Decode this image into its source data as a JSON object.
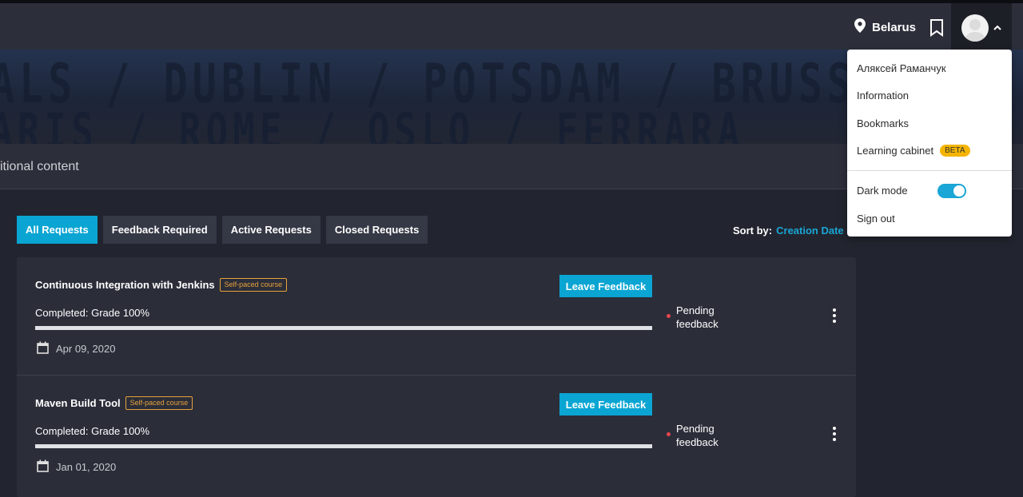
{
  "header": {
    "location": "Belarus",
    "icons": [
      "location-pin-icon",
      "bookmark-icon",
      "avatar-icon",
      "chevron-up-icon"
    ]
  },
  "banner": {
    "row1": "ALS / DUBLIN / POTSDAM / BRUSSELS",
    "row2": "ARIS / ROME / OSLO / FERRARA"
  },
  "subheader": {
    "text": "itional content"
  },
  "tabs": [
    {
      "label": "All Requests",
      "active": true
    },
    {
      "label": "Feedback Required",
      "active": false
    },
    {
      "label": "Active Requests",
      "active": false
    },
    {
      "label": "Closed Requests",
      "active": false
    }
  ],
  "sort": {
    "label": "Sort by:",
    "value": "Creation Date"
  },
  "requests": [
    {
      "title": "Continuous Integration with Jenkins",
      "badge": "Self-paced course",
      "button": "Leave Feedback",
      "completed": "Completed: Grade 100%",
      "progress_pct": 100,
      "date": "Apr 09, 2020",
      "status": "Pending feedback"
    },
    {
      "title": "Maven Build Tool",
      "badge": "Self-paced course",
      "button": "Leave Feedback",
      "completed": "Completed: Grade 100%",
      "progress_pct": 100,
      "date": "Jan 01, 2020",
      "status": "Pending feedback"
    }
  ],
  "menu": {
    "user_name": "Аляксей Раманчук",
    "information": "Information",
    "bookmarks": "Bookmarks",
    "learning_cabinet": "Learning cabinet",
    "beta": "BETA",
    "dark_mode": "Dark mode",
    "dark_mode_on": true,
    "sign_out": "Sign out"
  },
  "colors": {
    "accent": "#0aa5d3",
    "badge": "#e7a23a",
    "status_dot": "#e8454e",
    "beta": "#f4b400"
  }
}
